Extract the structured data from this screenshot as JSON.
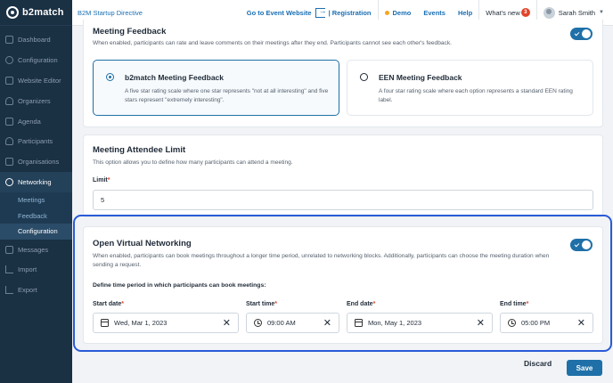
{
  "app": {
    "logo_text": "b2match",
    "event_name": "B2M Startup Directive"
  },
  "topbar": {
    "goto_label": "Go to Event Website",
    "registration_label": "| Registration",
    "demo_label": "Demo",
    "events_label": "Events",
    "help_label": "Help",
    "whats_new_label": "What's new",
    "whats_new_count": "3",
    "user_name": "Sarah Smith"
  },
  "sidebar": {
    "items": [
      {
        "label": "Dashboard",
        "icon": "dashboard-icon"
      },
      {
        "label": "Configuration",
        "icon": "configuration-icon"
      },
      {
        "label": "Website Editor",
        "icon": "website-editor-icon"
      },
      {
        "label": "Organizers",
        "icon": "organizers-icon"
      },
      {
        "label": "Agenda",
        "icon": "agenda-icon"
      },
      {
        "label": "Participants",
        "icon": "participants-icon"
      },
      {
        "label": "Organisations",
        "icon": "organisations-icon"
      },
      {
        "label": "Networking",
        "icon": "networking-icon",
        "active": true
      },
      {
        "label": "Messages",
        "icon": "messages-icon"
      },
      {
        "label": "Import",
        "icon": "import-icon"
      },
      {
        "label": "Export",
        "icon": "export-icon"
      }
    ],
    "networking_sub": [
      "Meetings",
      "Feedback",
      "Configuration"
    ]
  },
  "feedback": {
    "title": "Meeting Feedback",
    "desc": "When enabled, participants can rate and leave comments on their meetings after they end. Participants cannot see each other's feedback.",
    "options": [
      {
        "title": "b2match Meeting Feedback",
        "desc": "A five star rating scale where one star represents \"not at all interesting\" and five stars represent \"extremely interesting\".",
        "selected": true
      },
      {
        "title": "EEN Meeting Feedback",
        "desc": "A four star rating scale where each option represents a standard EEN rating label.",
        "selected": false
      }
    ]
  },
  "attendee": {
    "title": "Meeting Attendee Limit",
    "desc": "This option allows you to define how many participants can attend a meeting.",
    "limit_label": "Limit",
    "limit_value": "5"
  },
  "virtual": {
    "title": "Open Virtual Networking",
    "desc": "When enabled, participants can book meetings throughout a longer time period, unrelated to networking blocks. Additionally, participants can choose the meeting duration when sending a request.",
    "period_label": "Define time period in which participants can book meetings:",
    "start_date_label": "Start date",
    "start_date_value": "Wed, Mar 1, 2023",
    "start_time_label": "Start time",
    "start_time_value": "09:00 AM",
    "end_date_label": "End date",
    "end_date_value": "Mon, May 1, 2023",
    "end_time_label": "End time",
    "end_time_value": "05:00 PM"
  },
  "footer": {
    "discard_label": "Discard",
    "save_label": "Save"
  },
  "colors": {
    "accent": "#1f70a8",
    "sidebar": "#1a3043",
    "highlight": "#2a5bd7",
    "required": "#e0452b"
  }
}
